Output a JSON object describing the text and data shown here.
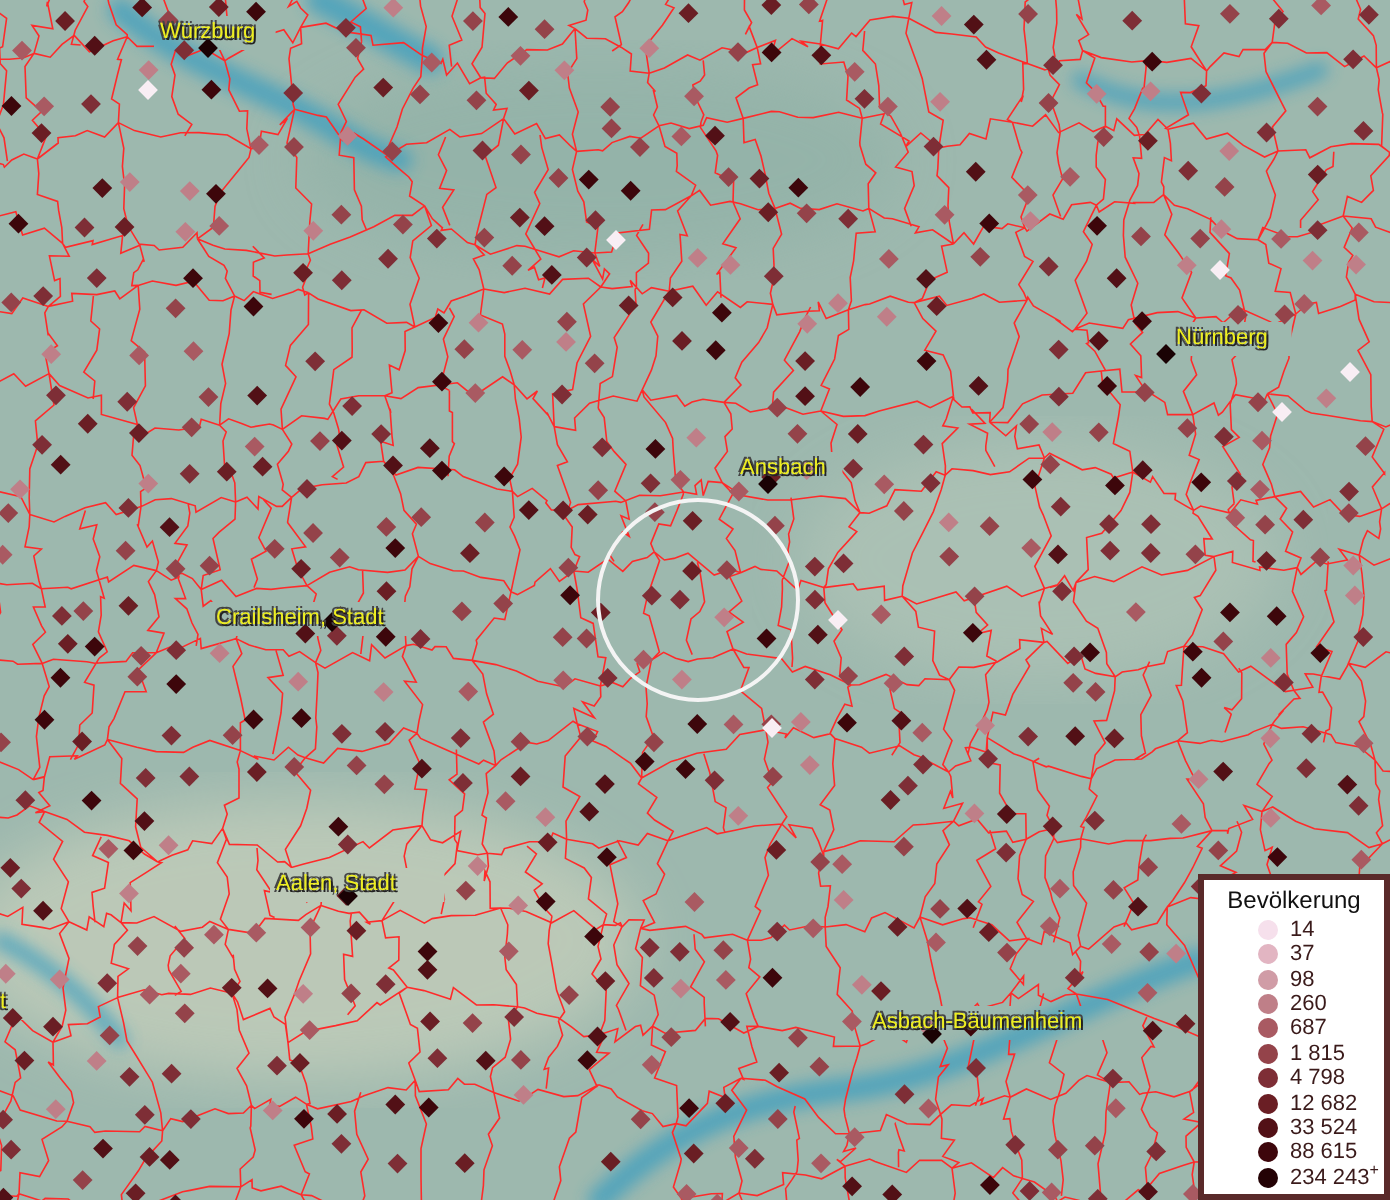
{
  "map": {
    "places": [
      {
        "name": "Würzburg"
      },
      {
        "name": "Nürnberg"
      },
      {
        "name": "Ansbach"
      },
      {
        "name": "Crailsheim, Stadt"
      },
      {
        "name": "Aalen, Stadt"
      },
      {
        "name": "Asbach-Bäumenheim"
      },
      {
        "name": "t"
      }
    ]
  },
  "legend": {
    "title": "Bevölkerung",
    "entries": [
      {
        "label": "14",
        "color": "#f6e0ec"
      },
      {
        "label": "37",
        "color": "#e2b5c2"
      },
      {
        "label": "98",
        "color": "#d09ca6"
      },
      {
        "label": "260",
        "color": "#bf7f88"
      },
      {
        "label": "687",
        "color": "#a95a62"
      },
      {
        "label": "1 815",
        "color": "#94434a"
      },
      {
        "label": "4 798",
        "color": "#7e2e36"
      },
      {
        "label": "12 682",
        "color": "#6a1e24"
      },
      {
        "label": "33 524",
        "color": "#521016"
      },
      {
        "label": "88 615",
        "color": "#3d060b"
      },
      {
        "label": "234 243$^{+}$",
        "color": "#240205"
      }
    ]
  }
}
